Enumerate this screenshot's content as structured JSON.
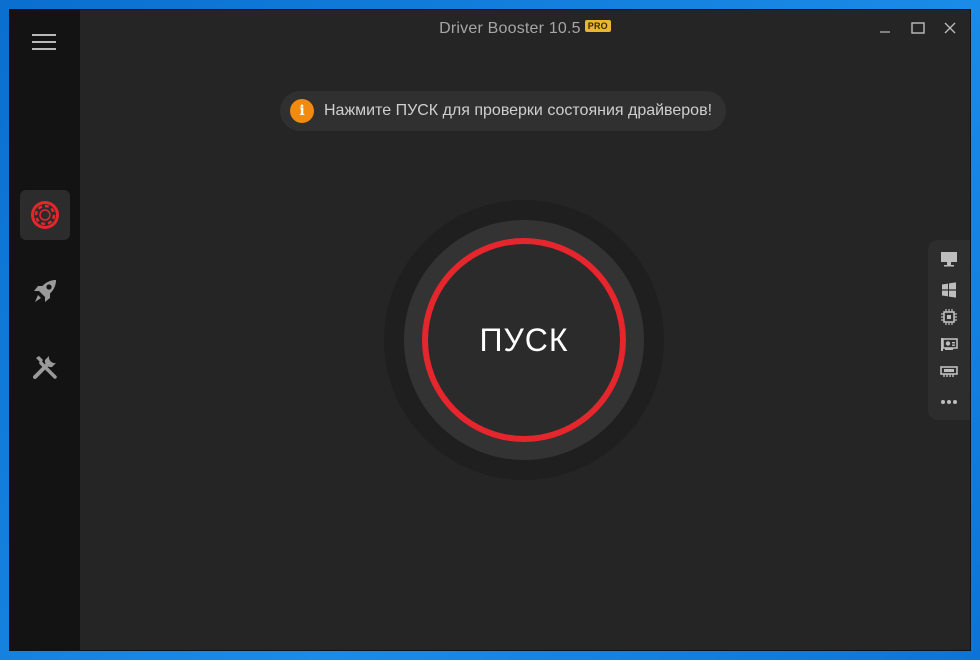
{
  "window": {
    "title": "Driver Booster 10.5",
    "badge": "PRO"
  },
  "controls": {
    "minimize": "minimize-icon",
    "maximize": "maximize-icon",
    "close": "close-icon"
  },
  "sidebar": {
    "menu_icon": "hamburger-menu-icon",
    "items": [
      {
        "icon": "driver-scan-icon",
        "active": true
      },
      {
        "icon": "rocket-boost-icon",
        "active": false
      },
      {
        "icon": "tools-icon",
        "active": false
      }
    ]
  },
  "notice": {
    "icon": "info-icon",
    "icon_glyph": "i",
    "text": "Нажмите ПУСК для проверки состояния драйверов!"
  },
  "scan": {
    "label": "ПУСК"
  },
  "right_panel": {
    "items": [
      {
        "icon": "monitor-icon"
      },
      {
        "icon": "windows-icon"
      },
      {
        "icon": "cpu-chip-icon"
      },
      {
        "icon": "graphics-card-icon"
      },
      {
        "icon": "memory-icon"
      },
      {
        "icon": "more-icon"
      }
    ]
  },
  "colors": {
    "accent": "#e5262c",
    "info": "#f08a10",
    "background": "#252525",
    "sidebar": "#131313",
    "badge": "#e8b630"
  }
}
